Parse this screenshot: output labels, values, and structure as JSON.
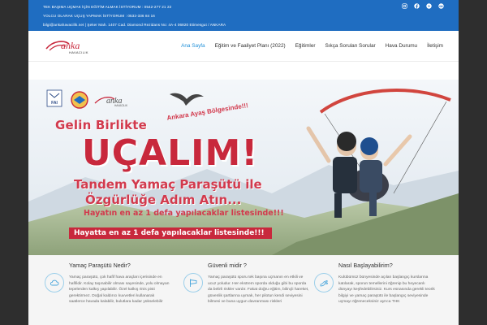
{
  "topbar": {
    "line1": "TEK BAŞIMA UÇMAK İÇİN EĞİTİM ALMAK İSTİYORUM : 0542-277 21 22",
    "line2": "YOLCU OLARAK UÇUŞ YAPMAK İSTİYORUM : 0532-336 84 16",
    "line3": "bilgi@ankahavacilik.net | Şeker Mah. 1407 Cad. Diamond Rezidans No: 4A-4 06820 Etimesgut / ANKARA",
    "social": [
      "instagram-icon",
      "facebook-icon",
      "youtube-icon",
      "tripadvisor-icon"
    ]
  },
  "logo": {
    "text": "anka",
    "sub": "HAVACILIK"
  },
  "nav": {
    "items": [
      {
        "label": "Ana Sayfa",
        "active": true
      },
      {
        "label": "Eğitim ve Faaliyet Planı (2022)",
        "active": false
      },
      {
        "label": "Eğitimler",
        "active": false
      },
      {
        "label": "Sıkça Sorulan Sorular",
        "active": false
      },
      {
        "label": "Hava Durumu",
        "active": false
      },
      {
        "label": "İletişim",
        "active": false
      }
    ],
    "accent": "#1f8fd8"
  },
  "hero": {
    "fai": "FAI",
    "logo_text": "anka",
    "logo_sub": "HAVACILIK",
    "line1": "Gelin Birlikte",
    "line1b": "Ankara Ayaş Bölgesinde!!!",
    "line2": "UÇALIM!",
    "line3": "Tandem Yamaç Paraşütü ile",
    "line4": "Özgürlüğe Adım Atın...",
    "line5": "Hayatın en az 1 defa yapılacaklar listesinde!!!",
    "ribbon": "Hayatta en az 1 defa yapılacaklar listesinde!!!",
    "accent": "#c8283c"
  },
  "features": [
    {
      "icon": "cloud-icon",
      "title": "Yamaç Paraşütü Nedir?",
      "text": "Yamaç paraşütü, çok hafif hava araçları içerisinde en hafifidir. Kolay taşınabilir olması sayesinde, yolu olmayan tepelerden kalkış yapılabilir. Özel kalkış rinis pisti gerektirmez. Doğal kaldırıcı kuvvetleri kullanarak saatlerce havada kalabilir, bulutlara kadar yükselebilir"
    },
    {
      "icon": "windsock-icon",
      "title": "Güvenli midir ?",
      "text": "Yamaç paraşütü sporu tek başına uçmanın en etkili ve ucuz yoludur. Her ekstrem sporda olduğu gibi bu sporda da belirli riskler vardır. Fakat doğru eğitim, bilinçli hareket, güvenlik şartlarına uymak, her pilotun kendi seviyesini bilmesi ve buna uygun davranması riskleri"
    },
    {
      "icon": "hand-icon",
      "title": "Nasıl Başlayabilirim?",
      "text": "Kulübümüz bünyesinde açılan başlangıç kurslarına katılarak, sporun temellerini öğrenip bu heyecanlı dünyayı keşfedebilirsiniz. Kurs esnasında gerekli teorik bilgiyi ve yamaç paraşütü ile başlangıç seviyesinde uçmayı öğreneceksiniz ayrıca THK"
    }
  ]
}
